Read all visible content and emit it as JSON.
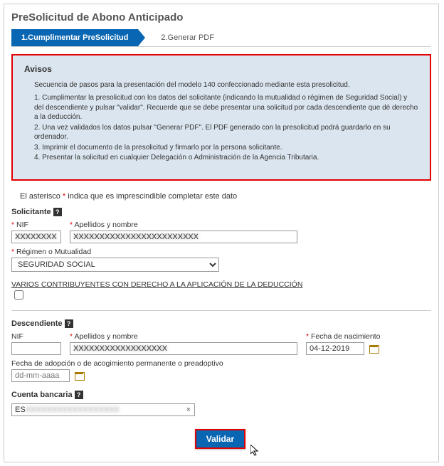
{
  "page_title": "PreSolicitud de Abono Anticipado",
  "steps": {
    "s1": "1.Cumplimentar PreSolicitud",
    "s2": "2.Generar PDF"
  },
  "avisos": {
    "title": "Avisos",
    "intro": "Secuencia de pasos para la presentación del modelo 140 confeccionado mediante esta presolicitud.",
    "items": [
      "1. Cumplimentar la presolicitud con los datos del solicitante (indicando la mutualidad o régimen de Seguridad Social) y del descendiente y pulsar \"validar\". Recuerde que se debe presentar una solicitud por cada descendiente que dé derecho a la deducción.",
      "2. Una vez validados los datos pulsar \"Generar PDF\". El PDF generado con la presolicitud podrá guardarlo en su ordenador.",
      "3. Imprimir el documento de la presolicitud y firmarlo por la persona solicitante.",
      "4. Presentar la solicitud en cualquier Delegación o Administración de la Agencia Tributaria."
    ]
  },
  "required_note_pre": "El asterisco ",
  "required_note_post": " indica que es imprescindible completar este dato",
  "solicitante": {
    "header": "Solicitante",
    "nif_label": "NIF",
    "nif_value": "XXXXXXXX",
    "apenom_label": "Apellidos y nombre",
    "apenom_value": "XXXXXXXXXXXXXXXXXXXXXXXX",
    "regimen_label": "Régimen o Mutualidad",
    "regimen_value": "SEGURIDAD SOCIAL",
    "varios_label": "VARIOS CONTRIBUYENTES CON DERECHO A LA APLICACIÓN DE LA DEDUCCIÓN"
  },
  "descendiente": {
    "header": "Descendiente",
    "nif_label": "NIF",
    "nif_value": "",
    "apenom_label": "Apellidos y nombre",
    "apenom_value": "XXXXXXXXXXXXXXXXXX",
    "fnac_label": "Fecha de nacimiento",
    "fnac_value": "04-12-2019",
    "fadop_label": "Fecha de adopción o de acogimiento permanente o preadoptivo",
    "fadop_placeholder": "dd-mm-aaaa"
  },
  "cuenta": {
    "header": "Cuenta bancaria",
    "iban_value": "ES",
    "iban_blurred": "XXXXXXXXXXXXXXXXXX"
  },
  "validar_label": "Validar"
}
